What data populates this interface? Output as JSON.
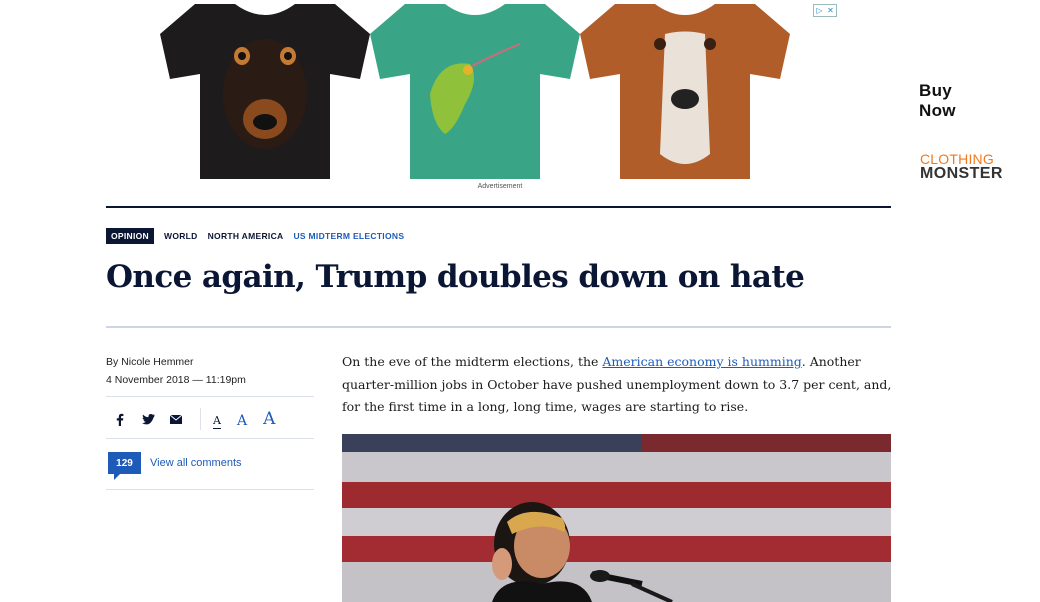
{
  "ad": {
    "buy_now": "Buy Now",
    "brand_line1": "CLOTHING",
    "brand_line2": "MONSTER",
    "label": "Advertisement",
    "choices_icon": "ad-choices-icon"
  },
  "breadcrumbs": {
    "opinion": "OPINION",
    "items": [
      "WORLD",
      "NORTH AMERICA",
      "US MIDTERM ELECTIONS"
    ]
  },
  "article": {
    "title": "Once again, Trump doubles down on hate",
    "author": "By Nicole Hemmer",
    "date": "4 November 2018 — 11:19pm",
    "lead_before": "On the eve of the midterm elections, the ",
    "lead_link": "American economy is humming",
    "lead_after": ". Another quarter-million jobs in October have pushed unemployment down to 3.7 per cent, and, for the first time in a long, long time, wages are starting to rise."
  },
  "tools": {
    "share_icons": [
      "facebook-icon",
      "twitter-icon",
      "email-icon"
    ],
    "font_small": "A",
    "font_medium": "A",
    "font_large": "A"
  },
  "comments": {
    "count": "129",
    "link": "View all comments"
  },
  "colors": {
    "navy": "#0a1633",
    "link_blue": "#1e5bb8",
    "ad_orange": "#f07a1c"
  }
}
